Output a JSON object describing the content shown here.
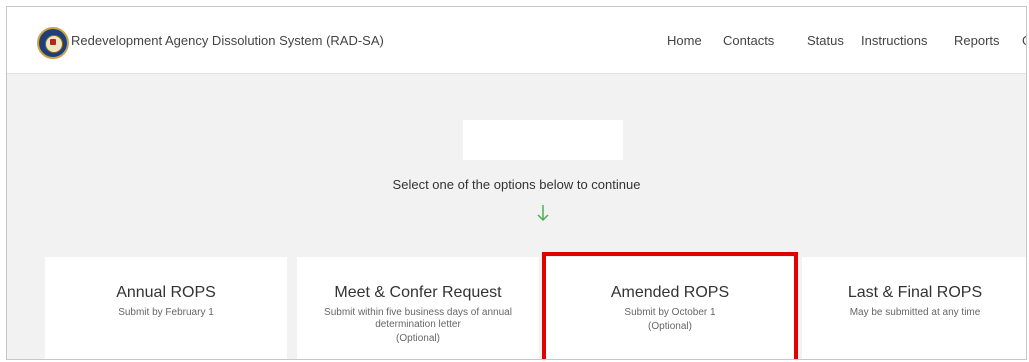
{
  "header": {
    "app_title": "Redevelopment Agency Dissolution System (RAD-SA)",
    "logo_icon": "state-seal-icon",
    "nav": [
      {
        "label": "Home"
      },
      {
        "label": "Contacts"
      },
      {
        "label": "Status"
      },
      {
        "label": "Instructions"
      },
      {
        "label": "Reports"
      },
      {
        "label": "G"
      }
    ]
  },
  "main": {
    "prompt": "Select one of the options below to continue",
    "arrow_icon": "arrow-down-icon",
    "accent_color": "#4caf50",
    "highlight_color": "#e00000",
    "cards": [
      {
        "title": "Annual ROPS",
        "subtitle": "Submit by February 1",
        "note": ""
      },
      {
        "title": "Meet & Confer Request",
        "subtitle": "Submit within five business days of annual determination letter",
        "note": "(Optional)"
      },
      {
        "title": "Amended ROPS",
        "subtitle": "Submit by October 1",
        "note": "(Optional)"
      },
      {
        "title": "Last & Final ROPS",
        "subtitle": "May be submitted at any time",
        "note": ""
      }
    ]
  }
}
